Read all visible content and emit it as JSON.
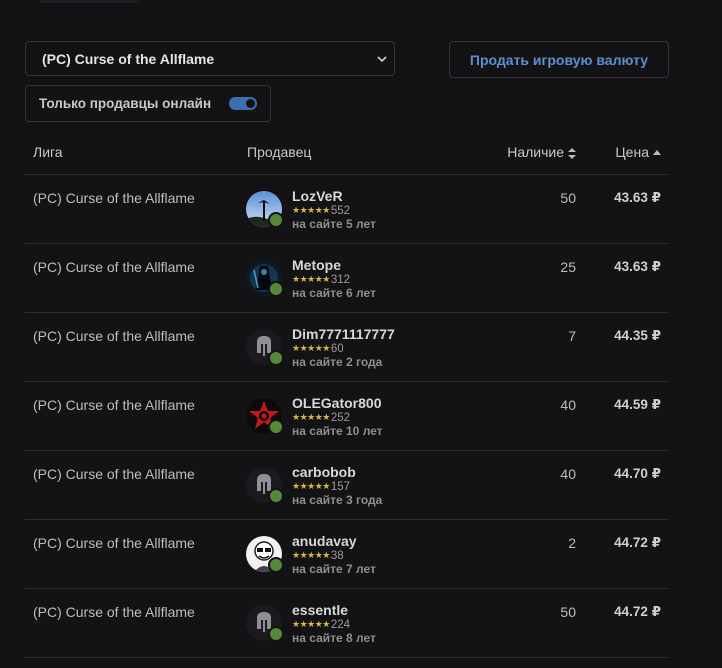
{
  "filters": {
    "league_select": "(PC) Curse of the Allflame",
    "online_only_label": "Только продавцы онлайн",
    "online_only_enabled": true
  },
  "sell_button_label": "Продать игровую валюту",
  "colors": {
    "accent": "#5c8fcf",
    "toggle_on": "#3d6fb0",
    "online_dot": "#54883a",
    "stars": "#d9b73a"
  },
  "table": {
    "headers": {
      "league": "Лига",
      "seller": "Продавец",
      "stock": "Наличие",
      "price": "Цена"
    },
    "rows": [
      {
        "league": "(PC) Curse of the Allflame",
        "seller": "LozVeR",
        "stars": "★★★★★",
        "reviews": "552",
        "tenure": "на сайте 5 лет",
        "stock": "50",
        "price": "43.63 ₽",
        "avatar": "photo-avatar"
      },
      {
        "league": "(PC) Curse of the Allflame",
        "seller": "Metope",
        "stars": "★★★★★",
        "reviews": "312",
        "tenure": "на сайте 6 лет",
        "stock": "25",
        "price": "43.63 ₽",
        "avatar": "dark-figure-avatar"
      },
      {
        "league": "(PC) Curse of the Allflame",
        "seller": "Dim7771117777",
        "stars": "★★★★★",
        "reviews": "60",
        "tenure": "на сайте 2 года",
        "stock": "7",
        "price": "44.35 ₽",
        "avatar": "default-helmet-avatar"
      },
      {
        "league": "(PC) Curse of the Allflame",
        "seller": "OLEGator800",
        "stars": "★★★★★",
        "reviews": "252",
        "tenure": "на сайте 10 лет",
        "stock": "40",
        "price": "44.59 ₽",
        "avatar": "red-emblem-avatar"
      },
      {
        "league": "(PC) Curse of the Allflame",
        "seller": "carbobob",
        "stars": "★★★★★",
        "reviews": "157",
        "tenure": "на сайте 3 года",
        "stock": "40",
        "price": "44.70 ₽",
        "avatar": "default-helmet-avatar"
      },
      {
        "league": "(PC) Curse of the Allflame",
        "seller": "anudavay",
        "stars": "★★★★★",
        "reviews": "38",
        "tenure": "на сайте 7 лет",
        "stock": "2",
        "price": "44.72 ₽",
        "avatar": "sketch-avatar"
      },
      {
        "league": "(PC) Curse of the Allflame",
        "seller": "essentle",
        "stars": "★★★★★",
        "reviews": "224",
        "tenure": "на сайте 8 лет",
        "stock": "50",
        "price": "44.72 ₽",
        "avatar": "default-helmet-avatar"
      }
    ]
  }
}
